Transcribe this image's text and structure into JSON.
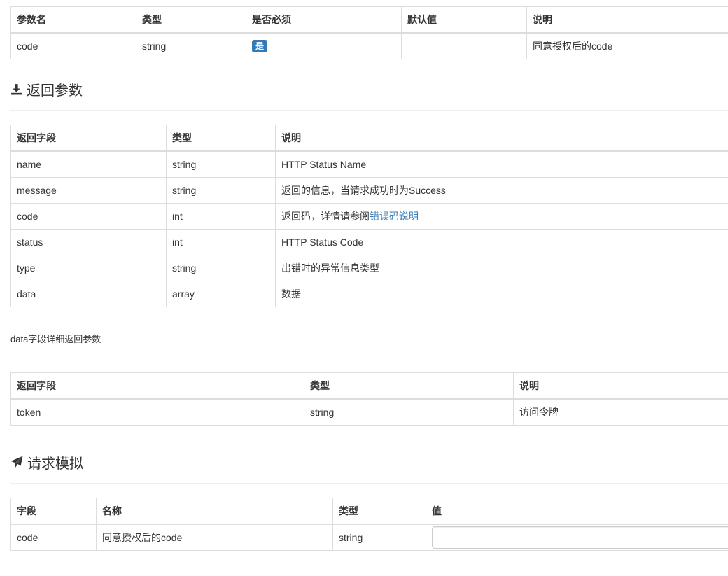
{
  "request_params": {
    "headers": [
      "参数名",
      "类型",
      "是否必须",
      "默认值",
      "说明"
    ],
    "rows": [
      {
        "name": "code",
        "type": "string",
        "required": "是",
        "default": "",
        "desc": "同意授权后的code"
      }
    ]
  },
  "return_section": {
    "title": "返回参数",
    "icon": "download-icon"
  },
  "return_params": {
    "headers": [
      "返回字段",
      "类型",
      "说明"
    ],
    "rows": [
      {
        "field": "name",
        "type": "string",
        "desc": "HTTP Status Name",
        "link": ""
      },
      {
        "field": "message",
        "type": "string",
        "desc": "返回的信息，当请求成功时为Success",
        "link": ""
      },
      {
        "field": "code",
        "type": "int",
        "desc": "返回码，详情请参阅",
        "link": "错误码说明"
      },
      {
        "field": "status",
        "type": "int",
        "desc": "HTTP Status Code",
        "link": ""
      },
      {
        "field": "type",
        "type": "string",
        "desc": "出错时的异常信息类型",
        "link": ""
      },
      {
        "field": "data",
        "type": "array",
        "desc": "数据",
        "link": ""
      }
    ]
  },
  "data_detail": {
    "label": "data字段详细返回参数",
    "headers": [
      "返回字段",
      "类型",
      "说明"
    ],
    "rows": [
      {
        "field": "token",
        "type": "string",
        "desc": "访问令牌"
      }
    ]
  },
  "simulate_section": {
    "title": "请求模拟",
    "icon": "paper-plane-icon"
  },
  "simulate": {
    "headers": [
      "字段",
      "名称",
      "类型",
      "值"
    ],
    "rows": [
      {
        "field": "code",
        "name": "同意授权后的code",
        "type": "string",
        "value": ""
      }
    ]
  }
}
